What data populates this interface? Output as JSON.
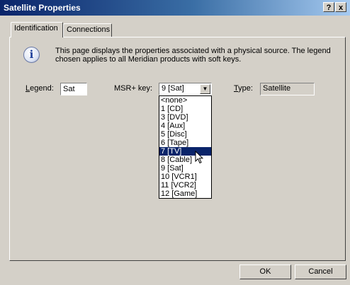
{
  "window": {
    "title": "Satellite Properties",
    "help_glyph": "?",
    "close_glyph": "x"
  },
  "tabs": [
    {
      "label": "Identification",
      "active": true
    },
    {
      "label": "Connections",
      "active": false
    }
  ],
  "info": {
    "icon": "info-icon",
    "text": "This page displays the properties associated with  a physical source. The legend chosen applies to all Meridian products with soft keys."
  },
  "fields": {
    "legend": {
      "accesskey": "L",
      "label_rest": "egend:",
      "value": "Sat"
    },
    "msr_key": {
      "label": "MSR+ key:",
      "value": "9 [Sat]"
    },
    "type": {
      "accesskey": "T",
      "label_rest": "ype:",
      "value": "Satellite"
    }
  },
  "dropdown": {
    "options": [
      "<none>",
      "1 [CD]",
      "3 [DVD]",
      "4 [Aux]",
      "5 [Disc]",
      "6 [Tape]",
      "7 [TV]",
      "8 [Cable]",
      "9 [Sat]",
      "10 [VCR1]",
      "11 [VCR2]",
      "12 [Game]"
    ],
    "highlighted": "7 [TV]"
  },
  "buttons": {
    "ok": "OK",
    "cancel": "Cancel"
  },
  "colors": {
    "face": "#d4d0c8",
    "selection": "#0a246a",
    "title_start": "#0a246a",
    "title_end": "#a6caf0"
  }
}
